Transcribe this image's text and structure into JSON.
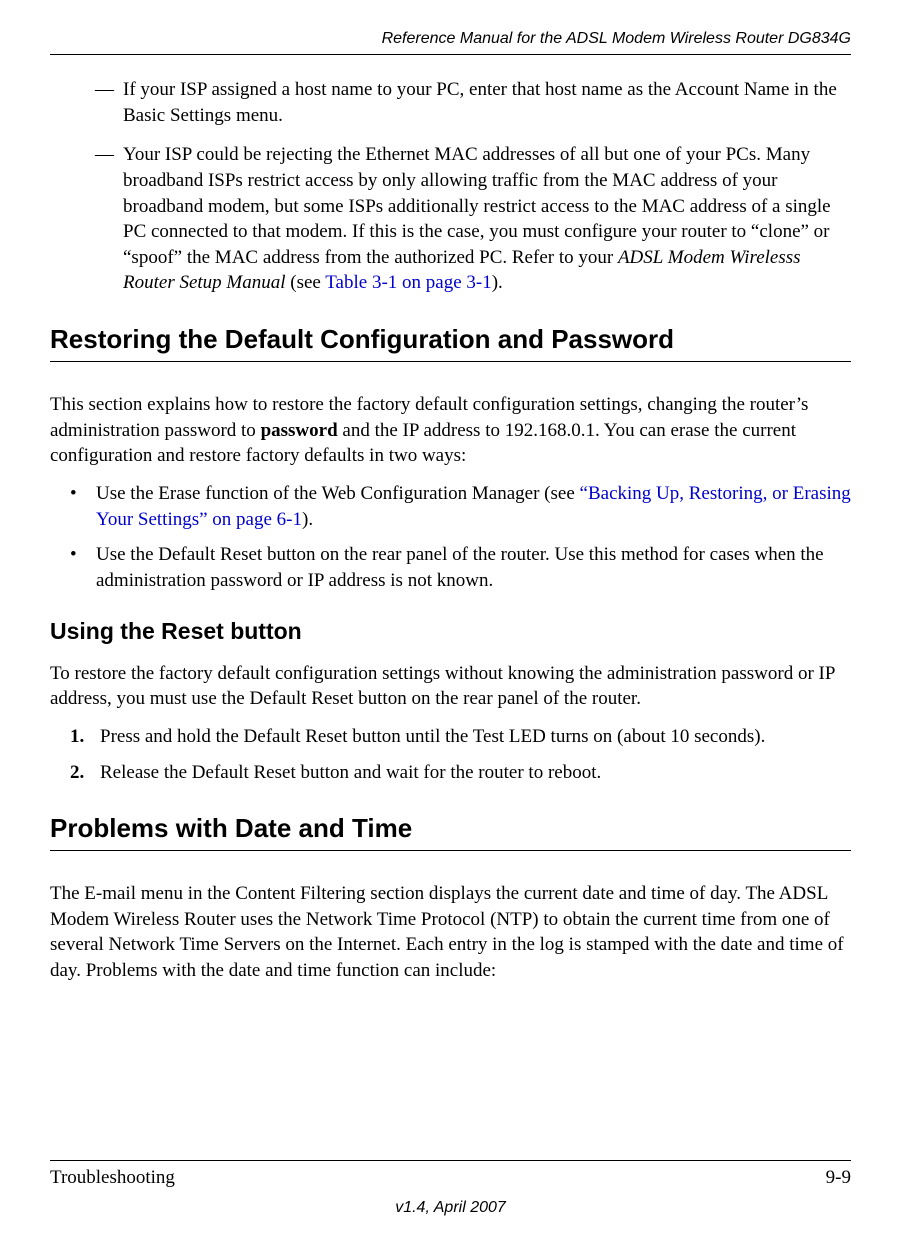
{
  "header": {
    "running_title": "Reference Manual for the ADSL Modem Wireless Router DG834G"
  },
  "dash_items": [
    {
      "text": "If your ISP assigned a host name to your PC, enter that host name as the Account Name in the Basic Settings menu."
    },
    {
      "pre": "Your ISP could be rejecting the Ethernet MAC addresses of all but one of your PCs. Many broadband ISPs restrict access by only allowing traffic from the MAC address of your broadband modem, but some ISPs additionally restrict access to the MAC address of a single PC connected to that modem. If this is the case, you must configure your router to “clone” or “spoof” the MAC address from the authorized PC. Refer to your ",
      "italic": "ADSL Modem Wirelesss Router Setup Manual",
      "mid": " (see ",
      "link": "Table 3-1 on page 3-1",
      "post": ")."
    }
  ],
  "section1": {
    "title": "Restoring the Default Configuration and Password",
    "para_pre": "This section explains how to restore the factory default configuration settings, changing the router’s administration password to ",
    "para_bold": "password",
    "para_post": " and the IP address to 192.168.0.1. You can erase the current configuration and restore factory defaults in two ways:",
    "bullets": [
      {
        "pre": "Use the Erase function of the Web Configuration Manager (see ",
        "link": "“Backing Up, Restoring, or Erasing Your Settings” on page 6-1",
        "post": ")."
      },
      {
        "text": "Use the Default Reset button on the rear panel of the router. Use this method for cases when the administration password or IP address is not known."
      }
    ]
  },
  "subsection1": {
    "title": "Using the Reset button",
    "para": "To restore the factory default configuration settings without knowing the administration password or IP address, you must use the Default Reset button on the rear panel of the router.",
    "steps": [
      {
        "num": "1.",
        "text": "Press and hold the Default Reset button until the Test LED turns on (about 10 seconds)."
      },
      {
        "num": "2.",
        "text": "Release the Default Reset button and wait for the router to reboot."
      }
    ]
  },
  "section2": {
    "title": "Problems with Date and Time",
    "para": "The E-mail menu in the Content Filtering section displays the current date and time of day. The ADSL Modem Wireless Router uses the Network Time Protocol (NTP) to obtain the current time from one of several Network Time Servers on the Internet. Each entry in the log is stamped with the date and time of day. Problems with the date and time function can include:"
  },
  "footer": {
    "left": "Troubleshooting",
    "right": "9-9",
    "version": "v1.4, April 2007"
  }
}
